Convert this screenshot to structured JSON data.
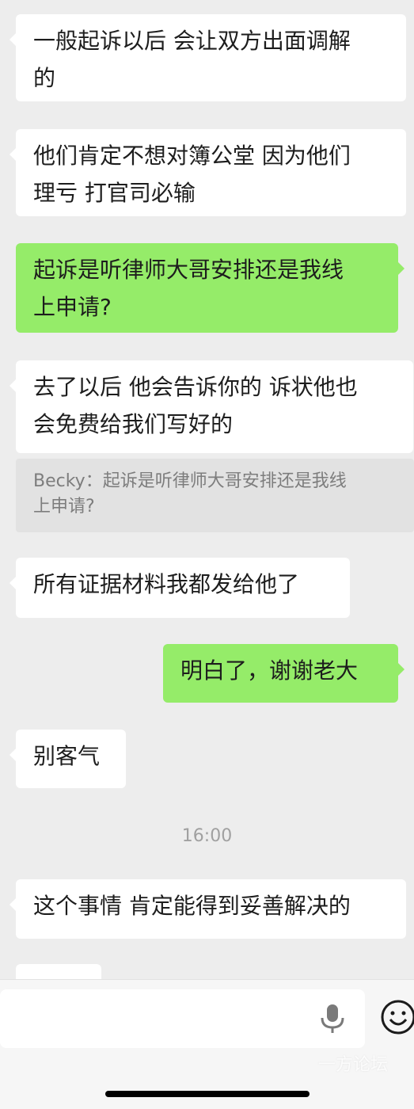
{
  "messages": [
    {
      "side": "in",
      "text": "一般起诉以后 会让双方出面调解\n的"
    },
    {
      "side": "in",
      "text": "他们肯定不想对簿公堂 因为他们\n理亏 打官司必输"
    },
    {
      "side": "out",
      "text": "起诉是听律师大哥安排还是我线\n上申请?"
    },
    {
      "side": "in",
      "text": "去了以后 他会告诉你的 诉状他也\n会免费给我们写好的"
    },
    {
      "side": "in",
      "text": "所有证据材料我都发给他了"
    },
    {
      "side": "out",
      "text": "明白了，谢谢老大"
    },
    {
      "side": "in",
      "text": "别客气"
    },
    {
      "side": "in",
      "text": "这个事情 肯定能得到妥善解决的"
    }
  ],
  "quote": {
    "text": "Becky：起诉是听律师大哥安排还是我线\n上申请?"
  },
  "timestamp": "16:00",
  "icons": {
    "voice": "microphone-icon",
    "emoji": "emoji-smile-icon"
  },
  "watermark": "一方论坛",
  "colors": {
    "background": "#ededed",
    "incoming_bubble": "#ffffff",
    "outgoing_bubble": "#95ec69",
    "quote_background": "#e2e2e2"
  }
}
